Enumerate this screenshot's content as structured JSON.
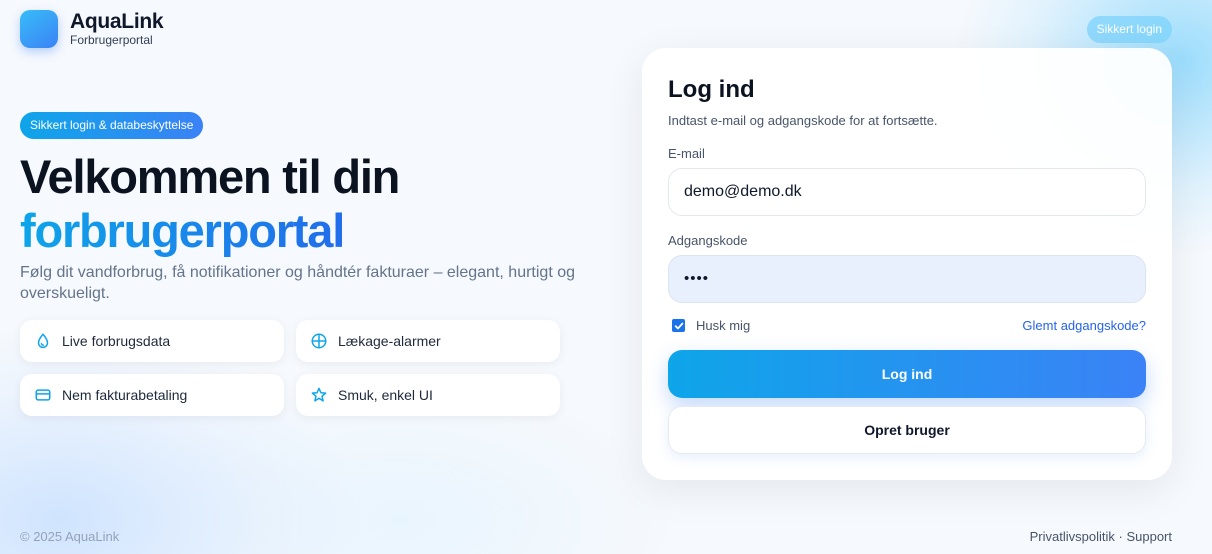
{
  "brand": {
    "name": "AquaLink",
    "subtitle": "Forbrugerportal"
  },
  "header": {
    "secure_pill": "Sikkert login"
  },
  "hero": {
    "badge": "Sikkert login & databeskyttelse",
    "title_line1": "Velkommen til din",
    "title_line2": "forbrugerportal",
    "description": "Følg dit vandforbrug, få notifikationer og håndtér fakturaer – elegant, hurtigt og overskueligt.",
    "features": [
      {
        "label": "Live forbrugsdata",
        "icon": "water-drop-icon"
      },
      {
        "label": "Lækage-alarmer",
        "icon": "globe-icon"
      },
      {
        "label": "Nem fakturabetaling",
        "icon": "credit-card-icon"
      },
      {
        "label": "Smuk, enkel UI",
        "icon": "star-icon"
      }
    ]
  },
  "login": {
    "title": "Log ind",
    "subtitle": "Indtast e-mail og adgangskode for at fortsætte.",
    "email_label": "E-mail",
    "email_value": "demo@demo.dk",
    "password_label": "Adgangskode",
    "password_mask": "••••",
    "remember_label": "Husk mig",
    "remember_checked": true,
    "forgot_label": "Glemt adgangskode?",
    "submit_label": "Log ind",
    "register_label": "Opret bruger"
  },
  "footer": {
    "copyright": "© 2025 AquaLink",
    "privacy": "Privatlivspolitik",
    "separator": " · ",
    "support": "Support"
  },
  "colors": {
    "accent_start": "#0ea5e9",
    "accent_end": "#3b82f6",
    "link": "#2563eb",
    "checkbox": "#1a73e8"
  }
}
